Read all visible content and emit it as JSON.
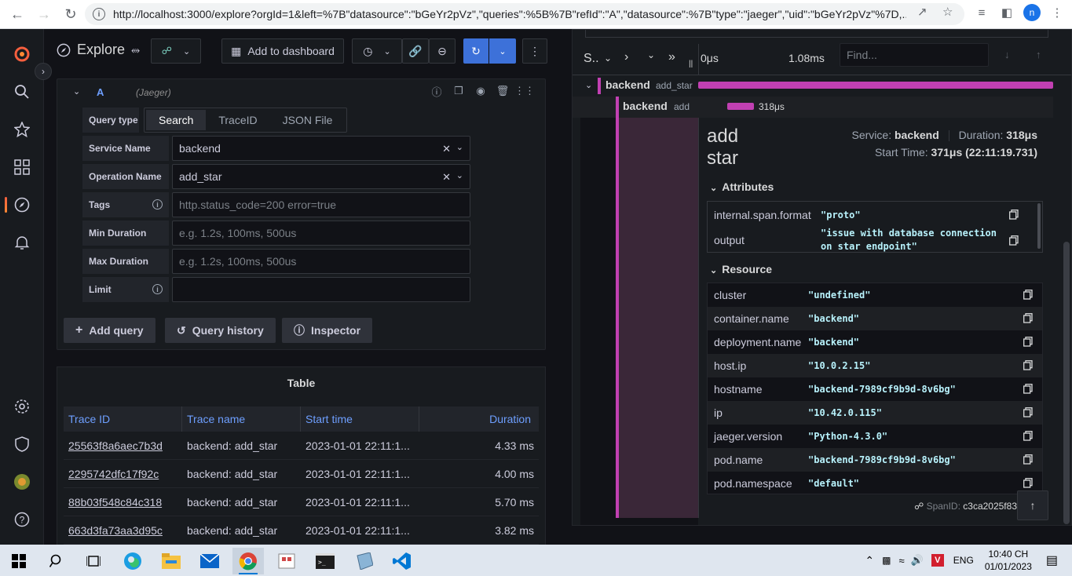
{
  "browser": {
    "url": "http://localhost:3000/explore?orgId=1&left=%7B\"datasource\":\"bGeYr2pVz\",\"queries\":%5B%7B\"refId\":\"A\",\"datasource\":%7B\"type\":\"jaeger\",\"uid\":\"bGeYr2pVz\"%7D,...",
    "profile_initial": "n"
  },
  "toolbar": {
    "title": "Explore",
    "add_to_dashboard": "Add to dashboard"
  },
  "query": {
    "letter": "A",
    "datasource": "(Jaeger)",
    "query_type_label": "Query type",
    "query_types": [
      "Search",
      "TraceID",
      "JSON File"
    ],
    "fields": [
      {
        "label": "Service Name",
        "value": "backend",
        "placeholder": "",
        "has_clear": true
      },
      {
        "label": "Operation Name",
        "value": "add_star",
        "placeholder": "",
        "has_clear": true
      },
      {
        "label": "Tags",
        "value": "",
        "placeholder": "http.status_code=200 error=true",
        "has_info": true
      },
      {
        "label": "Min Duration",
        "value": "",
        "placeholder": "e.g. 1.2s, 100ms, 500us"
      },
      {
        "label": "Max Duration",
        "value": "",
        "placeholder": "e.g. 1.2s, 100ms, 500us"
      },
      {
        "label": "Limit",
        "value": "",
        "placeholder": "",
        "has_info": true
      }
    ],
    "actions": {
      "add_query": "Add query",
      "query_history": "Query history",
      "inspector": "Inspector"
    }
  },
  "table": {
    "title": "Table",
    "columns": [
      "Trace ID",
      "Trace name",
      "Start time",
      "Duration"
    ],
    "rows": [
      [
        "25563f8a6aec7b3d",
        "backend: add_star",
        "2023-01-01 22:11:1...",
        "4.33 ms"
      ],
      [
        "2295742dfc17f92c",
        "backend: add_star",
        "2023-01-01 22:11:1...",
        "4.00 ms"
      ],
      [
        "88b03f548c84c318",
        "backend: add_star",
        "2023-01-01 22:11:1...",
        "5.70 ms"
      ],
      [
        "663d3fa73aa3d95c",
        "backend: add_star",
        "2023-01-01 22:11:1...",
        "3.82 ms"
      ]
    ]
  },
  "trace": {
    "col_label": "S..",
    "tick_0": "0μs",
    "tick_1": "1.08ms",
    "find_placeholder": "Find...",
    "spans": [
      {
        "service": "backend",
        "op": "add_star"
      },
      {
        "service": "backend",
        "op": "add",
        "duration": "318μs"
      }
    ],
    "detail": {
      "title": "add star",
      "service_label": "Service:",
      "service": "backend",
      "duration_label": "Duration:",
      "duration": "318μs",
      "start_label": "Start Time:",
      "start": "371μs (22:11:19.731)",
      "attributes_label": "Attributes",
      "attributes": [
        {
          "k": "internal.span.format",
          "v": "\"proto\""
        },
        {
          "k": "output",
          "v": "\"issue with database connection on star endpoint\""
        }
      ],
      "resource_label": "Resource",
      "resource": [
        {
          "k": "cluster",
          "v": "\"undefined\""
        },
        {
          "k": "container.name",
          "v": "\"backend\""
        },
        {
          "k": "deployment.name",
          "v": "\"backend\""
        },
        {
          "k": "host.ip",
          "v": "\"10.0.2.15\""
        },
        {
          "k": "hostname",
          "v": "\"backend-7989cf9b9d-8v6bg\""
        },
        {
          "k": "ip",
          "v": "\"10.42.0.115\""
        },
        {
          "k": "jaeger.version",
          "v": "\"Python-4.3.0\""
        },
        {
          "k": "pod.name",
          "v": "\"backend-7989cf9b9d-8v6bg\""
        },
        {
          "k": "pod.namespace",
          "v": "\"default\""
        }
      ],
      "span_id_label": "SpanID:",
      "span_id": "c3ca2025f83"
    }
  },
  "taskbar": {
    "time": "10:40 CH",
    "date": "01/01/2023",
    "lang": "ENG"
  },
  "colors": {
    "accent_blue": "#3d71d9",
    "link_blue": "#6e9fff",
    "span_magenta": "#c140b2",
    "grafana_orange": "#f55f3e"
  }
}
